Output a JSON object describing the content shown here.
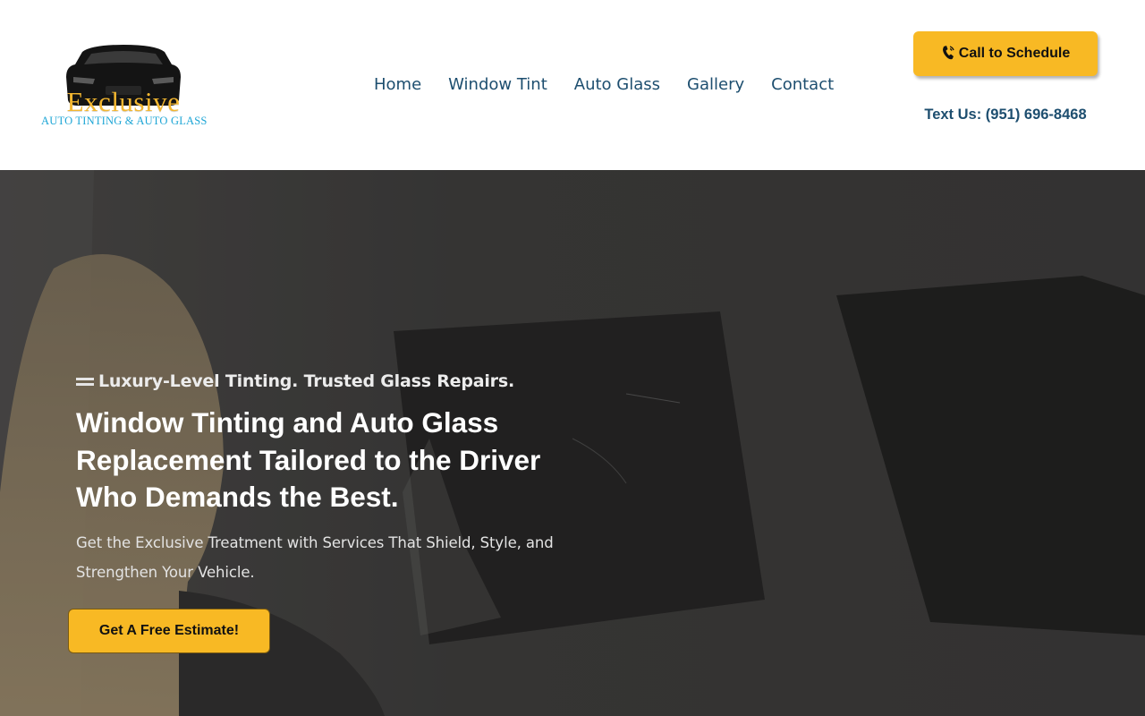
{
  "brand": {
    "logo_word": "Exclusive",
    "logo_sub": "AUTO TINTING & AUTO GLASS",
    "logo_icon": "sports-car-icon",
    "gold": "#f2b630",
    "blue": "#1ea6d6"
  },
  "nav": {
    "items": [
      {
        "label": "Home"
      },
      {
        "label": "Window Tint"
      },
      {
        "label": "Auto Glass"
      },
      {
        "label": "Gallery"
      },
      {
        "label": "Contact"
      }
    ],
    "color": "#1d4e6f"
  },
  "header_cta": {
    "call_label": "Call to Schedule",
    "call_icon": "phone-icon",
    "text_line": "Text Us: (951) 696-8468",
    "button_color": "#f8b924"
  },
  "hero": {
    "eyebrow": "Luxury-Level Tinting. Trusted Glass Repairs.",
    "title": "Window Tinting and Auto Glass Replacement Tailored to the Driver Who Demands the Best.",
    "subtitle": "Get the Exclusive Treatment with Services That Shield, Style, and Strengthen Your Vehicle.",
    "cta_label": "Get A Free Estimate!"
  }
}
